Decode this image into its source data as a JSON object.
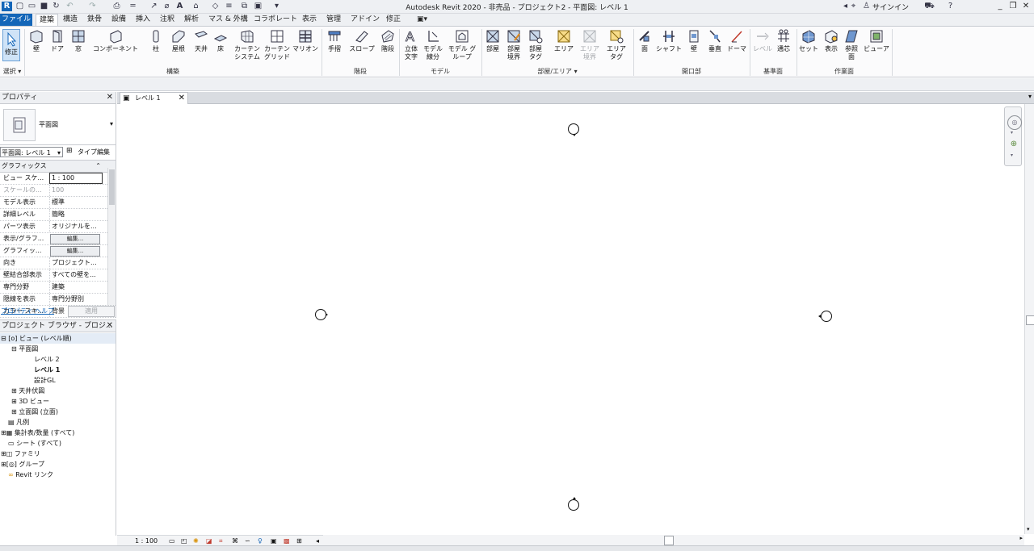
{
  "app": {
    "title": "Autodesk Revit 2020 - 非売品 - プロジェクト2 - 平面図: レベル 1",
    "sign_in": "サインイン",
    "accent": "#1466b8"
  },
  "tabs": [
    "ファイル",
    "建築",
    "構造",
    "鉄骨",
    "設備",
    "挿入",
    "注釈",
    "解析",
    "マス & 外構",
    "コラボレート",
    "表示",
    "管理",
    "アドイン",
    "修正"
  ],
  "ribbon": {
    "select_label": "修正",
    "select_panel": "選択",
    "tools": {
      "wall": "壁",
      "door": "ドア",
      "window": "窓",
      "component": "コンポーネント",
      "column": "柱",
      "roof": "屋根",
      "ceiling": "天井",
      "floor": "床",
      "curtain_system": "カーテン システム",
      "curtain_grid": "カーテン グリッド",
      "mullion": "マリオン",
      "railing": "手摺",
      "ramp": "スロープ",
      "stair": "階段",
      "model_text": "立体 文字",
      "model_line": "モデル 線分",
      "model_group": "モデル グループ",
      "room": "部屋",
      "room_separator": "部屋 境界",
      "room_tag": "部屋 タグ",
      "area": "エリア",
      "area_boundary": "エリア 境界",
      "area_tag": "エリア タグ",
      "by_face": "面",
      "shaft": "シャフト",
      "wall_opening": "壁",
      "vertical": "垂直",
      "dormer": "ドーマ",
      "level": "レベル",
      "grid": "通芯",
      "set": "セット",
      "show": "表示",
      "ref_plane": "参照 面",
      "viewer": "ビューア"
    },
    "panels": {
      "build": "構築",
      "circulation": "階段",
      "model": "モデル",
      "room_area": "部屋/エリア ▾",
      "opening": "開口部",
      "datum": "基準面",
      "work_plane": "作業面"
    }
  },
  "properties": {
    "title": "プロパティ",
    "type_name": "平面図",
    "view_selector": "平面図: レベル 1",
    "edit_type": "タイプ編集",
    "section": "グラフィックス",
    "rows": [
      {
        "k": "ビュー スケ...",
        "v": "1 : 100"
      },
      {
        "k": "スケールの...",
        "v": "100"
      },
      {
        "k": "モデル表示",
        "v": "標準"
      },
      {
        "k": "詳細レベル",
        "v": "簡略"
      },
      {
        "k": "パーツ表示",
        "v": "オリジナルを..."
      },
      {
        "k": "表示/グラフ...",
        "v": "編集..."
      },
      {
        "k": "グラフィッ...",
        "v": "編集..."
      },
      {
        "k": "向き",
        "v": "プロジェクト..."
      },
      {
        "k": "壁結合部表示",
        "v": "すべての壁を..."
      },
      {
        "k": "専門分野",
        "v": "建築"
      },
      {
        "k": "隠線を表示",
        "v": "専門分野別"
      },
      {
        "k": "カラー スキ...",
        "v": "背景"
      }
    ],
    "help_link": "プロパティ ヘルプ",
    "apply_button": "適用"
  },
  "browser": {
    "title": "プロジェクト ブラウザ - プロジ...",
    "root": "ビュー (レベル順)",
    "floor_plans": "平面図",
    "plan_items": [
      "レベル 2",
      "レベル 1",
      "設計GL"
    ],
    "ceiling_plans": "天井伏図",
    "views_3d": "3D ビュー",
    "elevations": "立面図 (立面)",
    "legends": "凡例",
    "schedules": "集計表/数量 (すべて)",
    "sheets": "シート (すべて)",
    "families": "ファミリ",
    "groups": "グループ",
    "links": "Revit リンク"
  },
  "view_tab": {
    "label": "レベル 1"
  },
  "view_control": {
    "scale": "1 : 100"
  }
}
